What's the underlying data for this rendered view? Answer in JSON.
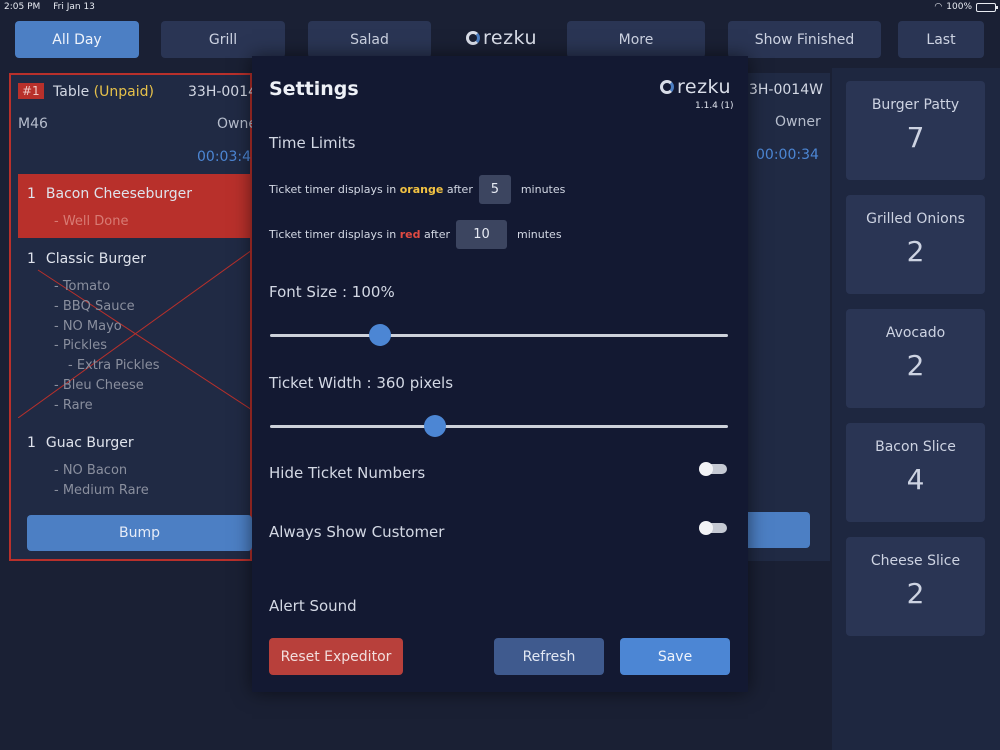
{
  "status_bar": {
    "time": "2:05 PM",
    "date": "Fri Jan 13",
    "battery": "100%",
    "battery_level": 1.0
  },
  "nav": {
    "tabs": [
      "All Day",
      "Grill",
      "Salad",
      "More",
      "Show Finished",
      "Last"
    ],
    "active": "All Day",
    "logo": "rezku"
  },
  "ticket": {
    "number": "#1",
    "table_label": "Table",
    "paid_status": "(Unpaid)",
    "ticket_id": "33H-0014",
    "ticket_id_right": "3H-0014W",
    "server": "M46",
    "owner": "Owne",
    "owner_right": "Owner",
    "timer": "00:03:4",
    "timer_right": "00:00:34",
    "items": [
      {
        "qty": "1",
        "name": "Bacon Cheeseburger",
        "mods": [
          "- Well Done"
        ]
      },
      {
        "qty": "1",
        "name": "Classic Burger",
        "mods": [
          "- Tomato",
          "- BBQ Sauce",
          "- NO Mayo",
          "- Pickles",
          "- Extra Pickles",
          "- Bleu Cheese",
          "- Rare"
        ]
      },
      {
        "qty": "1",
        "name": "Guac Burger",
        "mods": [
          "- NO Bacon",
          "- Medium Rare"
        ]
      }
    ],
    "bump_label": "Bump"
  },
  "counts": [
    {
      "name": "Burger Patty",
      "value": "7"
    },
    {
      "name": "Grilled Onions",
      "value": "2"
    },
    {
      "name": "Avocado",
      "value": "2"
    },
    {
      "name": "Bacon Slice",
      "value": "4"
    },
    {
      "name": "Cheese Slice",
      "value": "2"
    }
  ],
  "settings": {
    "title": "Settings",
    "logo": "rezku",
    "version": "1.1.4 (1)",
    "time_limits": {
      "heading": "Time Limits",
      "prefix": "Ticket timer displays in",
      "after": "after",
      "minutes": "minutes",
      "orange_word": "orange",
      "orange_value": "5",
      "red_word": "red",
      "red_value": "10"
    },
    "font_size": {
      "label": "Font Size : 100%",
      "slider_fraction": 0.24
    },
    "ticket_width": {
      "label": "Ticket Width : 360 pixels",
      "slider_fraction": 0.36
    },
    "hide_ticket_numbers": {
      "label": "Hide Ticket Numbers",
      "on": false
    },
    "always_show_customer": {
      "label": "Always Show Customer",
      "on": false
    },
    "alert_sound": {
      "label": "Alert Sound"
    },
    "buttons": {
      "reset": "Reset Expeditor",
      "refresh": "Refresh",
      "save": "Save"
    }
  },
  "colors": {
    "accent": "#4c7fc4",
    "ticket_red": "#b8302b",
    "orange_text": "#f2c242",
    "red_text": "#e04a42"
  }
}
